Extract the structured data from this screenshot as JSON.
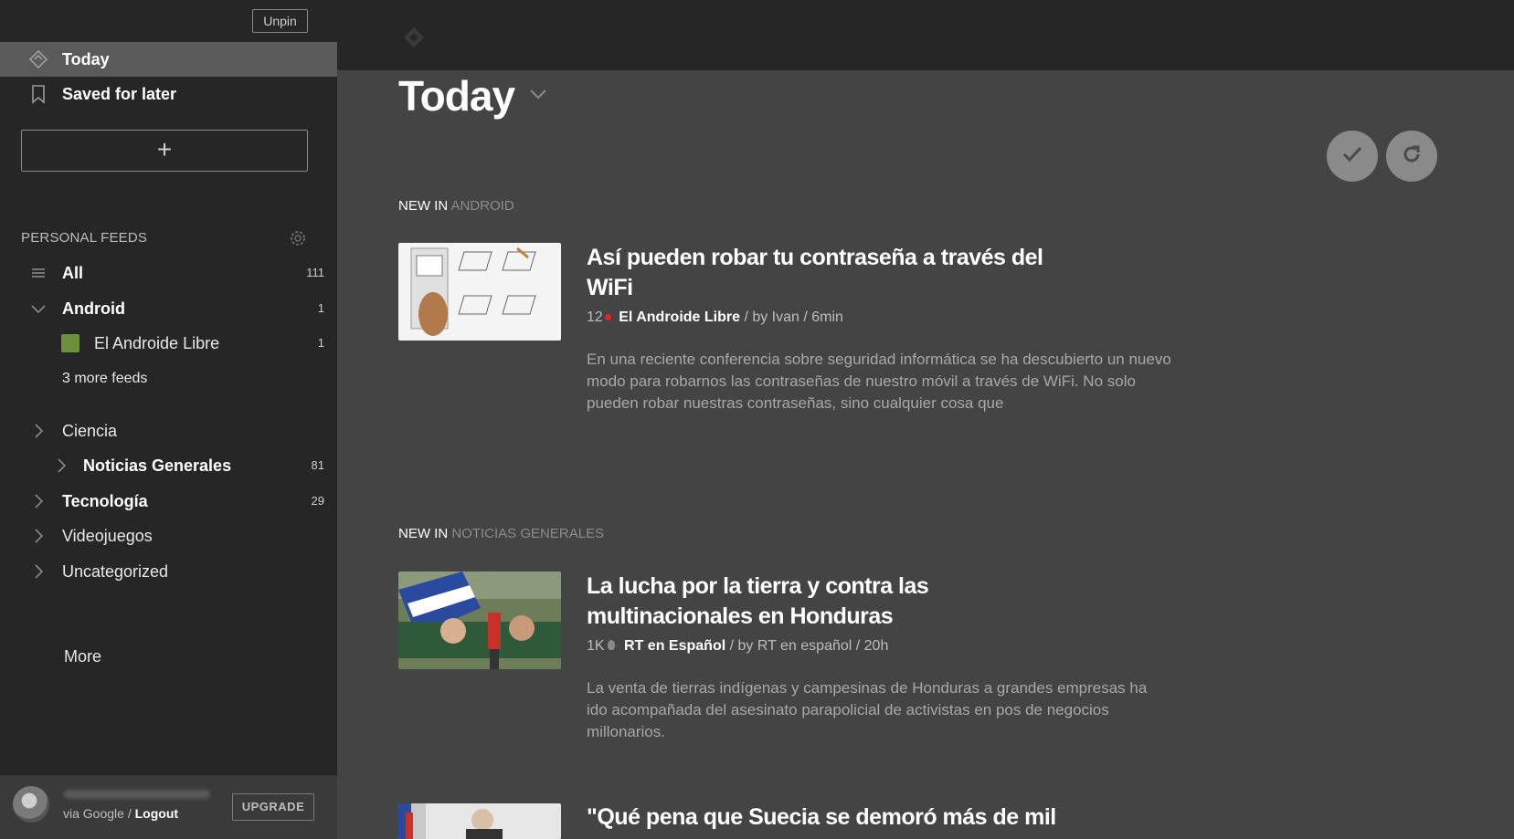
{
  "sidebar": {
    "unpin_label": "Unpin",
    "nav": [
      {
        "label": "Today",
        "icon": "today-icon"
      },
      {
        "label": "Saved for later",
        "icon": "bookmark-icon"
      }
    ],
    "add_label": "+",
    "section_title": "PERSONAL FEEDS",
    "feeds": [
      {
        "label": "All",
        "count": "111",
        "icon": "list-icon"
      },
      {
        "label": "Android",
        "count": "1",
        "icon": "chevron-down-icon"
      },
      {
        "label": "El Androide Libre",
        "count": "1",
        "icon": "feed-favicon"
      },
      {
        "label": "3 more feeds",
        "count": ""
      },
      {
        "label": "Ciencia",
        "count": "",
        "icon": "chevron-right-icon"
      },
      {
        "label": "Noticias Generales",
        "count": "81",
        "icon": "chevron-right-icon"
      },
      {
        "label": "Tecnología",
        "count": "29",
        "icon": "chevron-right-icon"
      },
      {
        "label": "Videojuegos",
        "count": "",
        "icon": "chevron-right-icon"
      },
      {
        "label": "Uncategorized",
        "count": "",
        "icon": "chevron-right-icon"
      }
    ],
    "more_label": "More",
    "footer": {
      "via_text": "via Google / ",
      "logout_label": "Logout",
      "upgrade_label": "UPGRADE"
    }
  },
  "main": {
    "title": "Today",
    "sections": [
      {
        "prefix": "NEW IN ",
        "category": "ANDROID",
        "article": {
          "title": "Así pueden robar tu contraseña a través del WiFi",
          "count": "12",
          "source": "El Androide Libre",
          "byline": " / by Ivan / 6min",
          "snippet": "En una reciente conferencia sobre seguridad informática se ha descubierto un nuevo modo para robarnos las contraseñas de nuestro móvil a través de WiFi. No solo pueden robar nuestras contraseñas, sino cualquier cosa que"
        }
      },
      {
        "prefix": "NEW IN ",
        "category": "NOTICIAS GENERALES",
        "article": {
          "title": "La lucha por la tierra y contra las multinacionales en Honduras",
          "count": "1K",
          "source": "RT en Español",
          "byline": " / by RT en español / 20h",
          "snippet": "La venta de tierras indígenas y campesinas de Honduras a grandes empresas ha ido acompañada del asesinato parapolicial de activistas en pos de negocios millonarios."
        }
      }
    ],
    "third_article_title": "\"Qué pena que Suecia se demoró más de mil"
  },
  "colors": {
    "sidebar_bg": "#262626",
    "main_bg": "#444444",
    "active_item_bg": "#5a5a5a",
    "unread_dot": "#e3242b"
  }
}
